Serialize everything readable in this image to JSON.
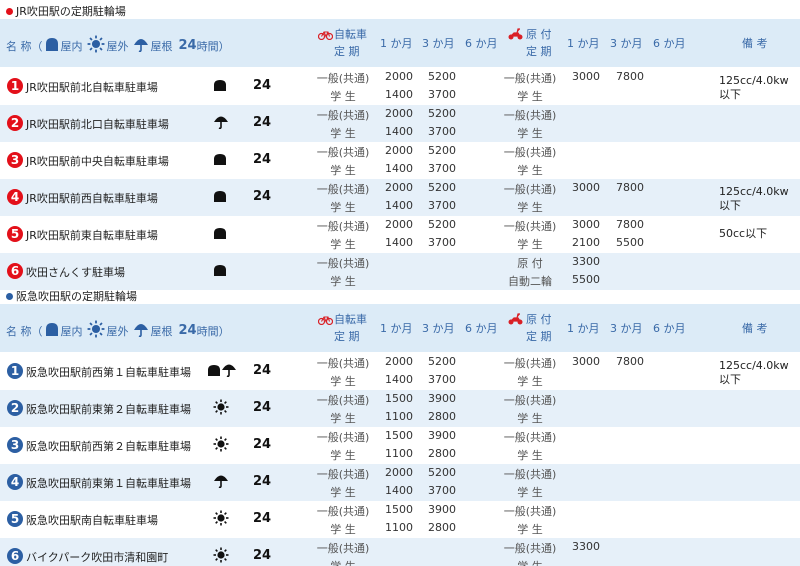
{
  "sections": [
    {
      "title": "JR吹田駅の定期駐輪場",
      "dot_color": "#e3101a",
      "badge_color": "red",
      "header": {
        "name": "名 称（",
        "indoor": "屋内",
        "outdoor": "屋外",
        "roof": "屋根",
        "hours": "24",
        "hours_suffix": "時間）",
        "bicycle_l1": "自転車",
        "bicycle_l2": "定 期",
        "m1": "1 か月",
        "m3": "3 か月",
        "m6": "6 か月",
        "moped_l1": "原 付",
        "moped_l2": "定 期",
        "m1b": "1 か月",
        "m3b": "3 か月",
        "m6b": "6 か月",
        "remarks": "備 考"
      },
      "rows": [
        {
          "num": "1",
          "name": "JR吹田駅前北自転車駐車場",
          "icons": [
            "indoor"
          ],
          "hours": "24",
          "cat1": "一般(共通)",
          "cat2": "学 生",
          "b1a": "2000",
          "b3a": "5200",
          "b1b": "1400",
          "b3b": "3700",
          "mcat1": "一般(共通)",
          "mcat2": "学 生",
          "m1a": "3000",
          "m3a": "7800",
          "m1b": "",
          "m3b": "",
          "note": "125cc/4.0kw 以下"
        },
        {
          "num": "2",
          "name": "JR吹田駅前北口自転車駐車場",
          "icons": [
            "roof"
          ],
          "hours": "24",
          "cat1": "一般(共通)",
          "cat2": "学 生",
          "b1a": "2000",
          "b3a": "5200",
          "b1b": "1400",
          "b3b": "3700",
          "mcat1": "一般(共通)",
          "mcat2": "学 生",
          "m1a": "",
          "m3a": "",
          "m1b": "",
          "m3b": "",
          "note": ""
        },
        {
          "num": "3",
          "name": "JR吹田駅前中央自転車駐車場",
          "icons": [
            "indoor"
          ],
          "hours": "24",
          "cat1": "一般(共通)",
          "cat2": "学 生",
          "b1a": "2000",
          "b3a": "5200",
          "b1b": "1400",
          "b3b": "3700",
          "mcat1": "一般(共通)",
          "mcat2": "学 生",
          "m1a": "",
          "m3a": "",
          "m1b": "",
          "m3b": "",
          "note": ""
        },
        {
          "num": "4",
          "name": "JR吹田駅前西自転車駐車場",
          "icons": [
            "indoor"
          ],
          "hours": "24",
          "cat1": "一般(共通)",
          "cat2": "学 生",
          "b1a": "2000",
          "b3a": "5200",
          "b1b": "1400",
          "b3b": "3700",
          "mcat1": "一般(共通)",
          "mcat2": "学 生",
          "m1a": "3000",
          "m3a": "7800",
          "m1b": "",
          "m3b": "",
          "note": "125cc/4.0kw 以下"
        },
        {
          "num": "5",
          "name": "JR吹田駅前東自転車駐車場",
          "icons": [
            "indoor"
          ],
          "hours": "",
          "cat1": "一般(共通)",
          "cat2": "学 生",
          "b1a": "2000",
          "b3a": "5200",
          "b1b": "1400",
          "b3b": "3700",
          "mcat1": "一般(共通)",
          "mcat2": "学 生",
          "m1a": "3000",
          "m3a": "7800",
          "m1b": "2100",
          "m3b": "5500",
          "note": "50cc以下"
        },
        {
          "num": "6",
          "name": "吹田さんくす駐車場",
          "icons": [
            "indoor"
          ],
          "hours": "",
          "cat1": "一般(共通)",
          "cat2": "学 生",
          "b1a": "",
          "b3a": "",
          "b1b": "",
          "b3b": "",
          "mcat1": "原 付",
          "mcat2": "自動二輪",
          "m1a": "3300",
          "m3a": "",
          "m1b": "5500",
          "m3b": "",
          "note": ""
        }
      ]
    },
    {
      "title": "阪急吹田駅の定期駐輪場",
      "dot_color": "#2c5fa3",
      "badge_color": "blue",
      "header": {
        "name": "名 称（",
        "indoor": "屋内",
        "outdoor": "屋外",
        "roof": "屋根",
        "hours": "24",
        "hours_suffix": "時間）",
        "bicycle_l1": "自転車",
        "bicycle_l2": "定 期",
        "m1": "1 か月",
        "m3": "3 か月",
        "m6": "6 か月",
        "moped_l1": "原 付",
        "moped_l2": "定 期",
        "m1b": "1 か月",
        "m3b": "3 か月",
        "m6b": "6 か月",
        "remarks": "備 考"
      },
      "rows": [
        {
          "num": "1",
          "name": "阪急吹田駅前西第１自転車駐車場",
          "icons": [
            "indoor",
            "roof"
          ],
          "hours": "24",
          "cat1": "一般(共通)",
          "cat2": "学 生",
          "b1a": "2000",
          "b3a": "5200",
          "b1b": "1400",
          "b3b": "3700",
          "mcat1": "一般(共通)",
          "mcat2": "学 生",
          "m1a": "3000",
          "m3a": "7800",
          "m1b": "",
          "m3b": "",
          "note": "125cc/4.0kw 以下"
        },
        {
          "num": "2",
          "name": "阪急吹田駅前東第２自転車駐車場",
          "icons": [
            "outdoor"
          ],
          "hours": "24",
          "cat1": "一般(共通)",
          "cat2": "学 生",
          "b1a": "1500",
          "b3a": "3900",
          "b1b": "1100",
          "b3b": "2800",
          "mcat1": "一般(共通)",
          "mcat2": "学 生",
          "m1a": "",
          "m3a": "",
          "m1b": "",
          "m3b": "",
          "note": ""
        },
        {
          "num": "3",
          "name": "阪急吹田駅前西第２自転車駐車場",
          "icons": [
            "outdoor"
          ],
          "hours": "24",
          "cat1": "一般(共通)",
          "cat2": "学 生",
          "b1a": "1500",
          "b3a": "3900",
          "b1b": "1100",
          "b3b": "2800",
          "mcat1": "一般(共通)",
          "mcat2": "学 生",
          "m1a": "",
          "m3a": "",
          "m1b": "",
          "m3b": "",
          "note": ""
        },
        {
          "num": "4",
          "name": "阪急吹田駅前東第１自転車駐車場",
          "icons": [
            "roof"
          ],
          "hours": "24",
          "cat1": "一般(共通)",
          "cat2": "学 生",
          "b1a": "2000",
          "b3a": "5200",
          "b1b": "1400",
          "b3b": "3700",
          "mcat1": "一般(共通)",
          "mcat2": "学 生",
          "m1a": "",
          "m3a": "",
          "m1b": "",
          "m3b": "",
          "note": ""
        },
        {
          "num": "5",
          "name": "阪急吹田駅南自転車駐車場",
          "icons": [
            "outdoor"
          ],
          "hours": "24",
          "cat1": "一般(共通)",
          "cat2": "学 生",
          "b1a": "1500",
          "b3a": "3900",
          "b1b": "1100",
          "b3b": "2800",
          "mcat1": "一般(共通)",
          "mcat2": "学 生",
          "m1a": "",
          "m3a": "",
          "m1b": "",
          "m3b": "",
          "note": ""
        },
        {
          "num": "6",
          "name": "バイクパーク吹田市清和園町",
          "icons": [
            "outdoor"
          ],
          "hours": "24",
          "cat1": "一般(共通)",
          "cat2": "学 生",
          "b1a": "",
          "b3a": "",
          "b1b": "",
          "b3b": "",
          "mcat1": "一般(共通)",
          "mcat2": "学 生",
          "m1a": "3300",
          "m3a": "",
          "m1b": "",
          "m3b": "",
          "note": ""
        }
      ]
    }
  ]
}
